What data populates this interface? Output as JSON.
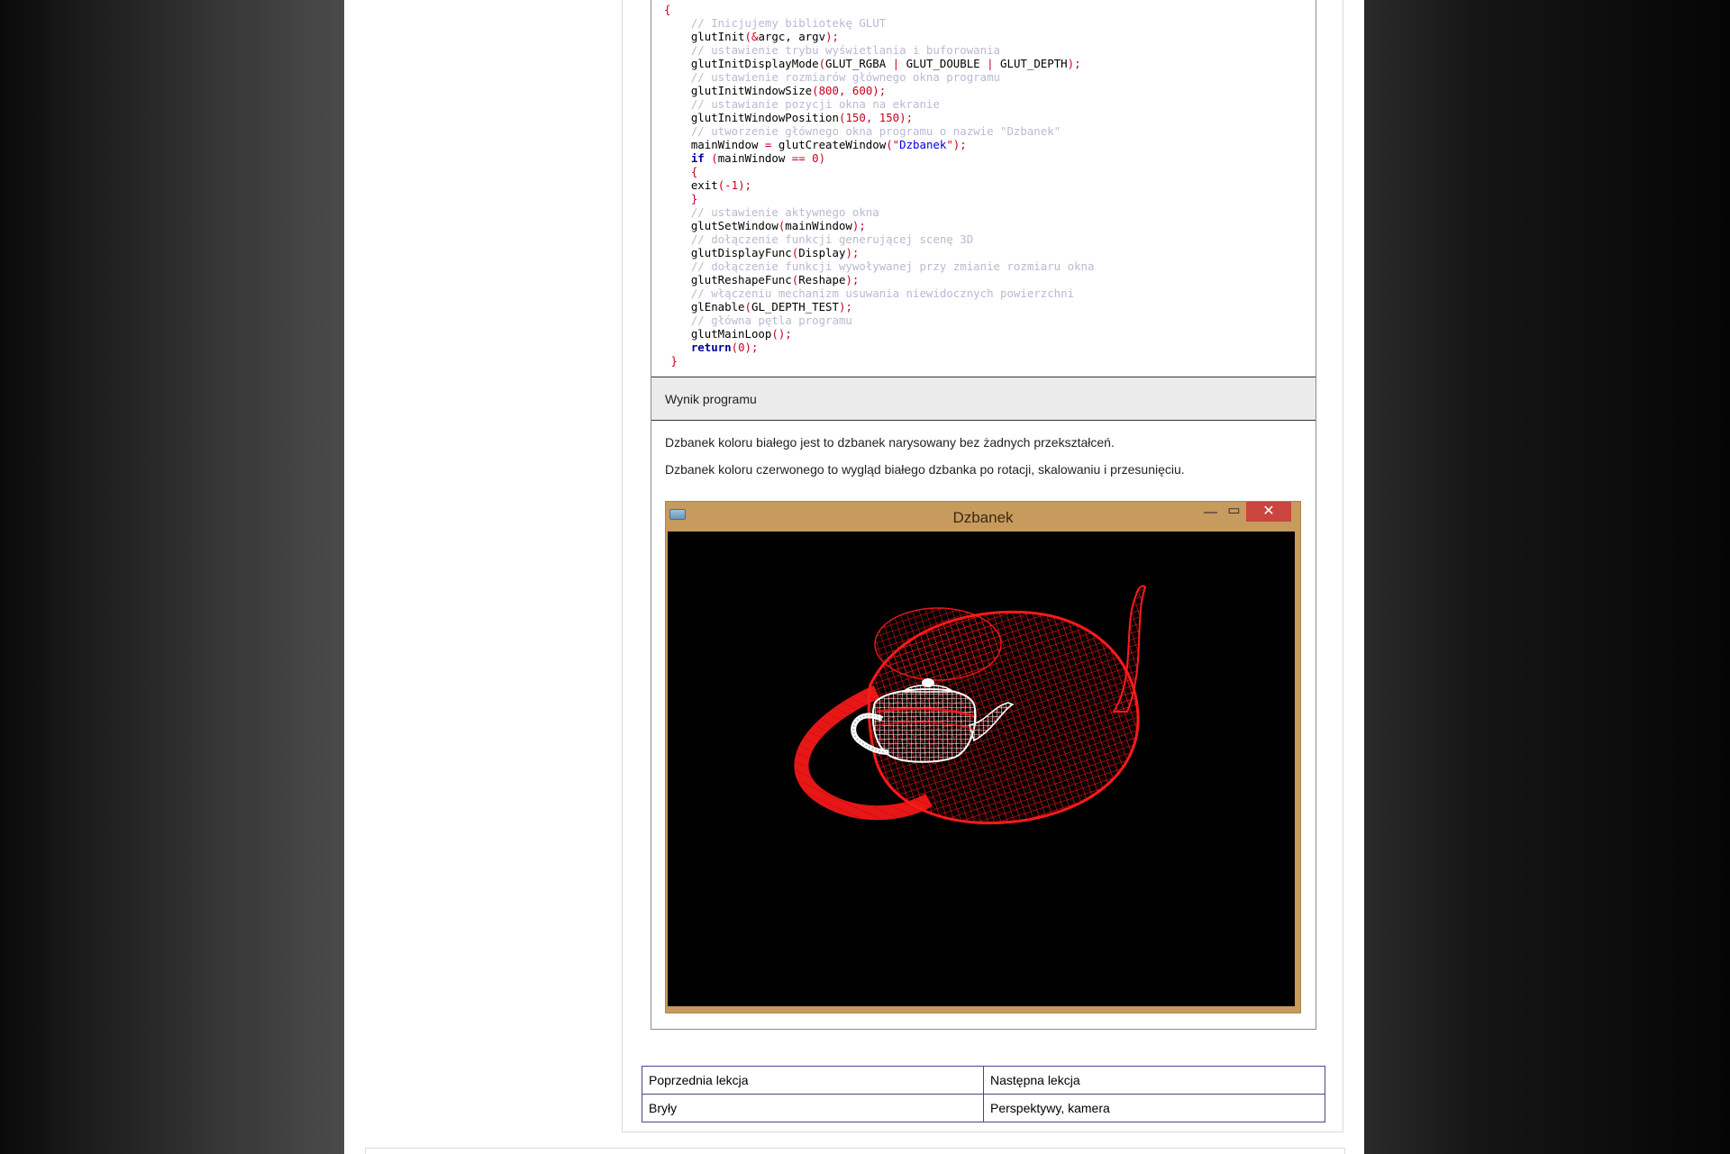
{
  "code": {
    "lines": [
      [
        {
          "t": "{",
          "k": "p"
        }
      ],
      [
        {
          "t": "    // Inicjujemy bibliotekę GLUT",
          "k": "c"
        }
      ],
      [
        {
          "t": "    glutInit"
        },
        {
          "t": "(&",
          "k": "p"
        },
        {
          "t": "argc, argv"
        },
        {
          "t": ");",
          "k": "p"
        }
      ],
      [
        {
          "t": "    // ustawienie trybu wyświetlania i buforowania",
          "k": "c"
        }
      ],
      [
        {
          "t": "    glutInitDisplayMode"
        },
        {
          "t": "(",
          "k": "p"
        },
        {
          "t": "GLUT_RGBA "
        },
        {
          "t": "|",
          "k": "p"
        },
        {
          "t": " GLUT_DOUBLE "
        },
        {
          "t": "|",
          "k": "p"
        },
        {
          "t": " GLUT_DEPTH"
        },
        {
          "t": ");",
          "k": "p"
        }
      ],
      [
        {
          "t": "    // ustawienie rozmiarów głównego okna programu",
          "k": "c"
        }
      ],
      [
        {
          "t": "    glutInitWindowSize"
        },
        {
          "t": "(",
          "k": "p"
        },
        {
          "t": "800",
          "k": "n"
        },
        {
          "t": ", ",
          "k": "p"
        },
        {
          "t": "600",
          "k": "n"
        },
        {
          "t": ");",
          "k": "p"
        }
      ],
      [
        {
          "t": "    // ustawianie pozycji okna na ekranie",
          "k": "c"
        }
      ],
      [
        {
          "t": "    glutInitWindowPosition"
        },
        {
          "t": "(",
          "k": "p"
        },
        {
          "t": "150",
          "k": "n"
        },
        {
          "t": ", ",
          "k": "p"
        },
        {
          "t": "150",
          "k": "n"
        },
        {
          "t": ");",
          "k": "p"
        }
      ],
      [
        {
          "t": "    // utworzenie głównego okna programu o nazwie \"Dzbanek\"",
          "k": "c"
        }
      ],
      [
        {
          "t": "    mainWindow "
        },
        {
          "t": "=",
          "k": "p"
        },
        {
          "t": " glutCreateWindow"
        },
        {
          "t": "(\"",
          "k": "p"
        },
        {
          "t": "Dzbanek",
          "k": "s"
        },
        {
          "t": "\");",
          "k": "p"
        }
      ],
      [
        {
          "t": "    "
        },
        {
          "t": "if",
          "k": "k"
        },
        {
          "t": " (",
          "k": "p"
        },
        {
          "t": "mainWindow "
        },
        {
          "t": "==",
          "k": "p"
        },
        {
          "t": " "
        },
        {
          "t": "0",
          "k": "n"
        },
        {
          "t": ")",
          "k": "p"
        }
      ],
      [
        {
          "t": "    {",
          "k": "p"
        }
      ],
      [
        {
          "t": "    exit"
        },
        {
          "t": "(-",
          "k": "p"
        },
        {
          "t": "1",
          "k": "n"
        },
        {
          "t": ");",
          "k": "p"
        }
      ],
      [
        {
          "t": "    }",
          "k": "p"
        }
      ],
      [
        {
          "t": "    // ustawienie aktywnego okna",
          "k": "c"
        }
      ],
      [
        {
          "t": "    glutSetWindow"
        },
        {
          "t": "(",
          "k": "p"
        },
        {
          "t": "mainWindow"
        },
        {
          "t": ");",
          "k": "p"
        }
      ],
      [
        {
          "t": "    // dołączenie funkcji generującej scenę 3D",
          "k": "c"
        }
      ],
      [
        {
          "t": "    glutDisplayFunc"
        },
        {
          "t": "(",
          "k": "p"
        },
        {
          "t": "Display"
        },
        {
          "t": ");",
          "k": "p"
        }
      ],
      [
        {
          "t": "    // dołączenie funkcji wywoływanej przy zmianie rozmiaru okna",
          "k": "c"
        }
      ],
      [
        {
          "t": "    glutReshapeFunc"
        },
        {
          "t": "(",
          "k": "p"
        },
        {
          "t": "Reshape"
        },
        {
          "t": ");",
          "k": "p"
        }
      ],
      [
        {
          "t": "    // włączeniu mechanizm usuwania niewidocznych powierzchni",
          "k": "c"
        }
      ],
      [
        {
          "t": "    glEnable"
        },
        {
          "t": "(",
          "k": "p"
        },
        {
          "t": "GL_DEPTH_TEST"
        },
        {
          "t": ");",
          "k": "p"
        }
      ],
      [
        {
          "t": "    // główna pętla programu",
          "k": "c"
        }
      ],
      [
        {
          "t": "    glutMainLoop"
        },
        {
          "t": "();",
          "k": "p"
        }
      ],
      [
        {
          "t": "    "
        },
        {
          "t": "return",
          "k": "k"
        },
        {
          "t": "(",
          "k": "p"
        },
        {
          "t": "0",
          "k": "n"
        },
        {
          "t": ");",
          "k": "p"
        }
      ],
      [
        {
          "t": " }",
          "k": "p"
        }
      ]
    ]
  },
  "result": {
    "header": "Wynik programu",
    "paragraph_1": "Dzbanek koloru białego jest to dzbanek narysowany bez żadnych przekształceń.",
    "paragraph_2": "Dzbanek koloru czerwonego to wygląd białego dzbanka po rotacji, skalowaniu i przesunięciu."
  },
  "glut_window": {
    "title": "Dzbanek",
    "minimize_glyph": "—",
    "maximize_glyph": "▭",
    "close_glyph": "✕",
    "app_icon": "glut-window-icon",
    "colors": {
      "frame": "#c79a5e",
      "canvas": "#000000",
      "red_teapot": "#ff0000",
      "white_teapot": "#ffffff"
    }
  },
  "navigation": {
    "prev_header": "Poprzednia lekcja",
    "next_header": "Następna lekcja",
    "prev_link": "Bryły",
    "next_link": "Perspektywy, kamera"
  }
}
